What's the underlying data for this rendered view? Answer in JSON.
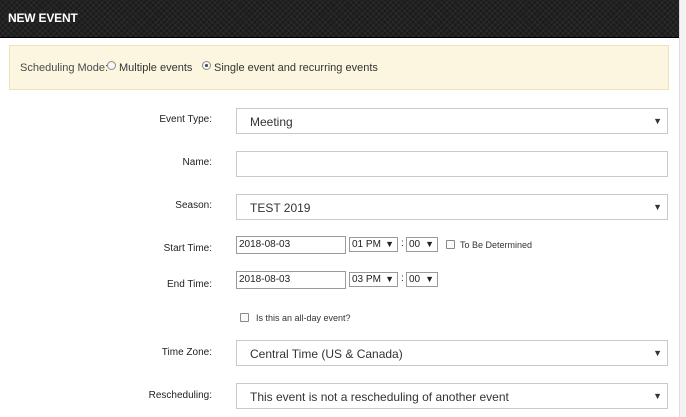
{
  "header": {
    "title": "NEW EVENT"
  },
  "scheduling": {
    "label": "Scheduling Mode:",
    "options": [
      {
        "label": "Multiple events",
        "checked": false
      },
      {
        "label": "Single event and recurring events",
        "checked": true
      }
    ]
  },
  "form": {
    "event_type": {
      "label": "Event Type:",
      "value": "Meeting"
    },
    "name": {
      "label": "Name:",
      "value": ""
    },
    "season": {
      "label": "Season:",
      "value": "TEST 2019"
    },
    "start_time": {
      "label": "Start Time:",
      "date": "2018-08-03",
      "hour": "01 PM",
      "minute": "00",
      "tbd_label": "To Be Determined"
    },
    "end_time": {
      "label": "End Time:",
      "date": "2018-08-03",
      "hour": "03 PM",
      "minute": "00"
    },
    "all_day": {
      "label": "Is this an all-day event?"
    },
    "time_zone": {
      "label": "Time Zone:",
      "value": "Central Time (US & Canada)"
    },
    "rescheduling": {
      "label": "Rescheduling:",
      "value": "This event is not a rescheduling of another event"
    }
  },
  "icons": {
    "dropdown": "▼",
    "separator": ":"
  }
}
